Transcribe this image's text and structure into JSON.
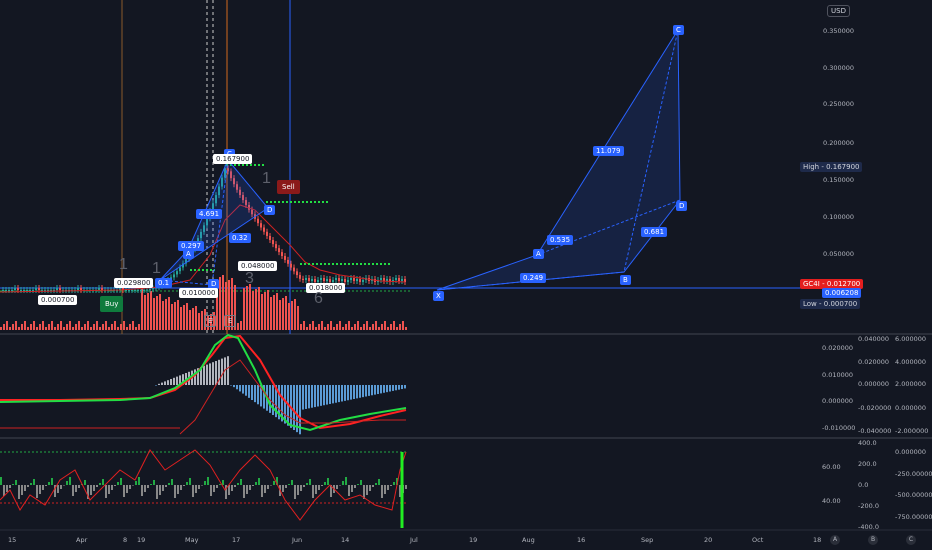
{
  "currency": "USD",
  "price_axis": {
    "ticks": [
      "0.350000",
      "0.300000",
      "0.250000",
      "0.200000",
      "0.150000",
      "0.100000",
      "0.050000",
      "0.000000"
    ],
    "high_label": "High",
    "high_value": "0.167900",
    "last_label": "GC4I",
    "last_value": "0.012700",
    "second_value": "0.006208",
    "low_label": "Low",
    "low_value": "0.000700"
  },
  "time_axis": [
    "15",
    "Apr",
    "8",
    "19",
    "May",
    "17",
    "Jun",
    "14",
    "Jul",
    "19",
    "Aug",
    "16",
    "Sep",
    "20",
    "Oct",
    "18"
  ],
  "macd_axis": {
    "left": [
      "0.020000",
      "0.010000",
      "0.000000",
      "-0.010000"
    ],
    "right_a": [
      "0.040000",
      "0.020000",
      "0.000000",
      "-0.020000",
      "-0.040000"
    ],
    "right_b": [
      "6.000000",
      "4.000000",
      "2.000000",
      "0.000000",
      "-2.000000"
    ]
  },
  "osc_axis": {
    "left": [
      "60.00",
      "40.00"
    ],
    "mid": [
      "400.0",
      "200.0",
      "0.0",
      "-200.0",
      "-400.0"
    ],
    "right": [
      "0.000000",
      "-250.000000",
      "-500.000000",
      "-750.000000"
    ]
  },
  "harmonic_pattern": {
    "points": [
      "X",
      "A",
      "B",
      "C",
      "D"
    ],
    "ratios": [
      "0.249",
      "0.535",
      "11.079",
      "0.681"
    ]
  },
  "small_pattern": {
    "points": [
      "A",
      "C",
      "D",
      "D"
    ],
    "ratios": [
      "4.691",
      "0.297",
      "0.32",
      "0.1"
    ]
  },
  "signals": {
    "buy": "Buy",
    "sell": "Sell"
  },
  "price_labels": [
    "0.167900",
    "0.029800",
    "0.000700",
    "0.048000",
    "0.010000",
    "0.018000"
  ],
  "wave_labels": [
    "1",
    "1",
    "3",
    "6",
    "1",
    "E",
    "E"
  ],
  "colors": {
    "bull": "#26a69a",
    "bear": "#ef5350",
    "pattern": "#2962ff",
    "macd_signal": "#ff2a2a",
    "macd_line": "#22dd44"
  }
}
